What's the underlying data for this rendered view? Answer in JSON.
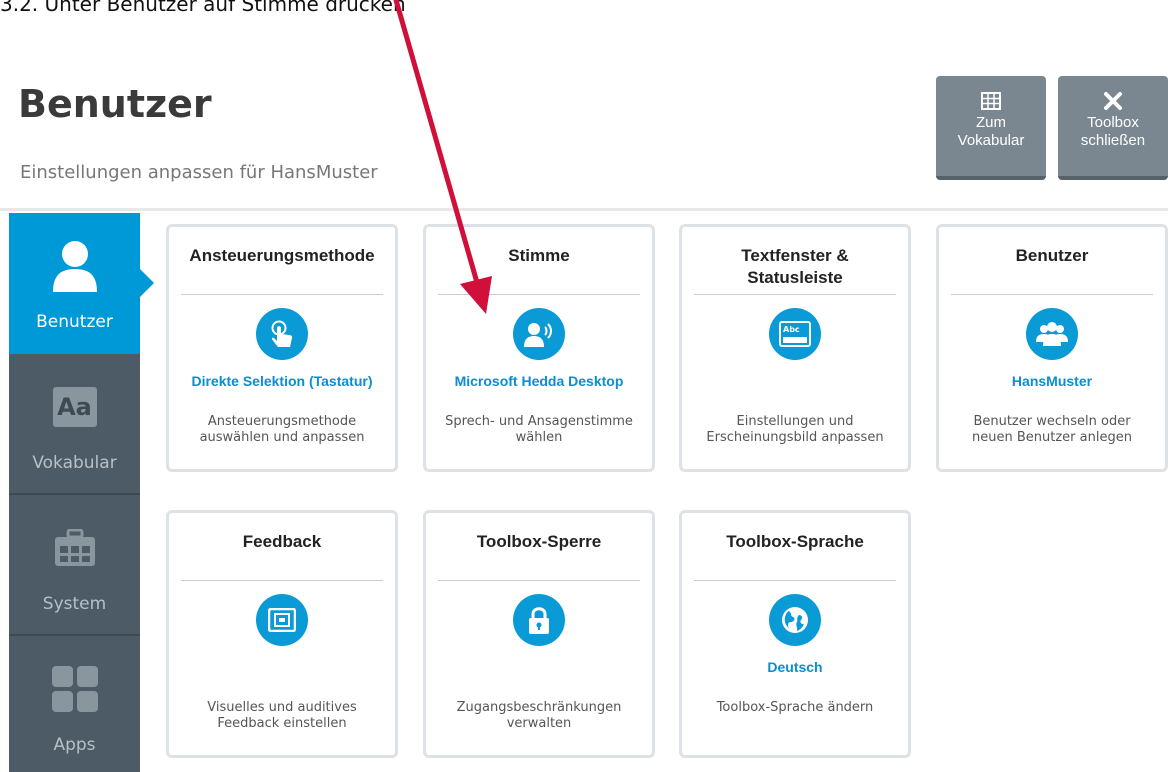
{
  "instruction": "3.2.  Unter Benutzer auf Stimme drücken",
  "header": {
    "title": "Benutzer",
    "subtitle": "Einstellungen anpassen für HansMuster",
    "buttons": {
      "vocab_label": "Zum\nVokabular",
      "vocab_icon": "grid-icon",
      "close_label": "Toolbox\nschließen",
      "close_icon": "close-icon"
    }
  },
  "sidebar": {
    "items": [
      {
        "label": "Benutzer",
        "icon": "user-icon",
        "active": true
      },
      {
        "label": "Vokabular",
        "icon_text": "Aa",
        "icon": "vocabulary-icon"
      },
      {
        "label": "System",
        "icon": "toolbox-icon"
      },
      {
        "label": "Apps",
        "icon": "apps-icon"
      }
    ]
  },
  "tiles": [
    {
      "title": "Ansteuerungsmethode",
      "value": "Direkte Selektion (Tastatur)",
      "desc": "Ansteuerungsmethode\nauswählen und anpassen",
      "icon": "touch-icon"
    },
    {
      "title": "Stimme",
      "value": "Microsoft Hedda Desktop",
      "desc": "Sprech- und Ansagenstimme\nwählen",
      "icon": "voice-icon"
    },
    {
      "title": "Textfenster &\nStatusleiste",
      "value": "",
      "desc": "Einstellungen und\nErscheinungsbild anpassen",
      "icon": "text-window-icon",
      "icon_text": "Abc"
    },
    {
      "title": "Benutzer",
      "value": "HansMuster",
      "desc": "Benutzer wechseln oder\nneuen Benutzer anlegen",
      "icon": "users-icon"
    },
    {
      "title": "Feedback",
      "value": "",
      "desc": "Visuelles und auditives\nFeedback einstellen",
      "icon": "feedback-icon"
    },
    {
      "title": "Toolbox-Sperre",
      "value": "",
      "desc": "Zugangsbeschränkungen\nverwalten",
      "icon": "lock-icon"
    },
    {
      "title": "Toolbox-Sprache",
      "value": "Deutsch",
      "desc": "Toolbox-Sprache ändern",
      "icon": "globe-icon"
    }
  ],
  "colors": {
    "accent": "#0099d8",
    "sidebar": "#4c5b65",
    "button": "#7a8790",
    "arrow": "#d0103a"
  }
}
